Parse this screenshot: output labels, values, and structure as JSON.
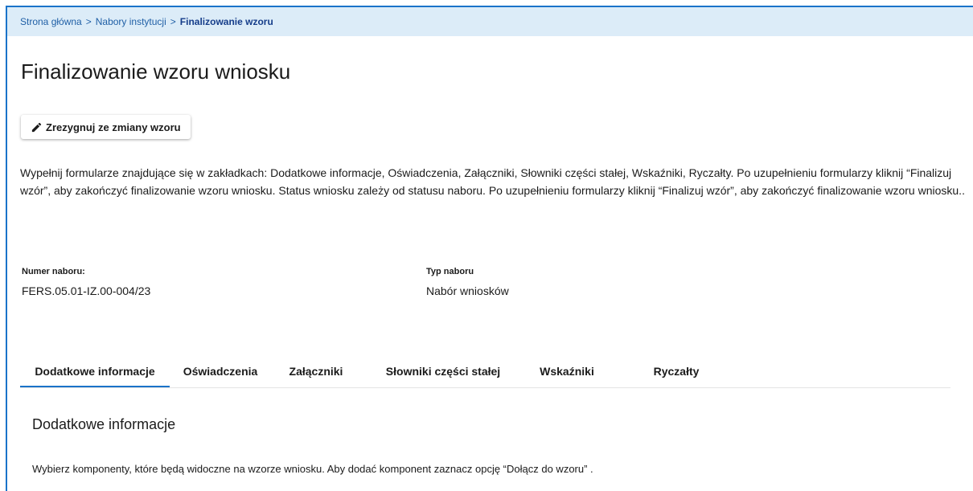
{
  "breadcrumb": {
    "items": [
      "Strona główna",
      "Nabory instytucji",
      "Finalizowanie wzoru"
    ],
    "separator": ">"
  },
  "page": {
    "title": "Finalizowanie wzoru wniosku",
    "resign_button_label": "Zrezygnuj ze zmiany wzoru",
    "resign_button_icon": "pencil-icon",
    "intro": "Wypełnij formularze znajdujące się w zakładkach: Dodatkowe informacje, Oświadczenia, Załączniki, Słowniki części stałej, Wskaźniki, Ryczałty. Po uzupełnieniu formularzy kliknij “Finalizuj wzór”, aby zakończyć finalizowanie wzoru wniosku. Status wniosku zależy od statusu naboru. Po uzupełnieniu formularzy kliknij “Finalizuj wzór”, aby zakończyć finalizowanie wzoru wniosku.."
  },
  "info": {
    "numer_label": "Numer naboru:",
    "numer_value": "FERS.05.01-IZ.00-004/23",
    "typ_label": "Typ naboru",
    "typ_value": "Nabór wniosków"
  },
  "tabs": [
    {
      "label": "Dodatkowe informacje",
      "active": true
    },
    {
      "label": "Oświadczenia",
      "active": false
    },
    {
      "label": "Załączniki",
      "active": false
    },
    {
      "label": "Słowniki części stałej",
      "active": false
    },
    {
      "label": "Wskaźniki",
      "active": false
    },
    {
      "label": "Ryczałty",
      "active": false
    }
  ],
  "section": {
    "title": "Dodatkowe informacje",
    "description": "Wybierz komponenty, które będą widoczne na wzorze wniosku. Aby dodać komponent zaznacz opcję “Dołącz do wzoru” ."
  },
  "colors": {
    "accent": "#1a73c9",
    "breadcrumb_bg": "#dcecf8",
    "link": "#1f5fa6"
  }
}
